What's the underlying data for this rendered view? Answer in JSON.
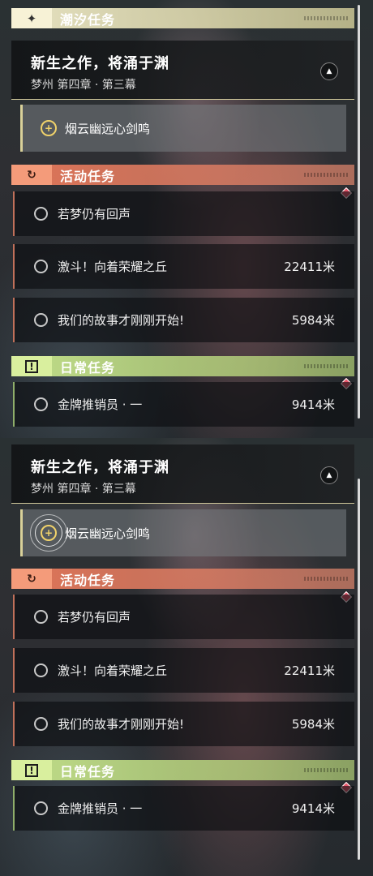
{
  "panels": [
    {
      "sections": {
        "tide": {
          "title": "潮汐任务",
          "icon": "star-icon"
        },
        "event": {
          "title": "活动任务",
          "icon": "refresh-icon"
        },
        "daily": {
          "title": "日常任务",
          "icon": "exclamation-box-icon"
        }
      },
      "main_quest": {
        "name": "新生之作，将涌于渊",
        "chapter": "梦州 第四章 · 第三幕"
      },
      "objective": {
        "label": "烟云幽远心剑鸣"
      },
      "event_tasks": [
        {
          "name": "若梦仍有回声",
          "distance": ""
        },
        {
          "name": "激斗！向着荣耀之丘",
          "distance": "22411米"
        },
        {
          "name": "我们的故事才刚刚开始!",
          "distance": "5984米"
        }
      ],
      "daily_tasks": [
        {
          "name": "金牌推销员 · 一",
          "distance": "9414米"
        }
      ]
    },
    {
      "sections": {
        "event": {
          "title": "活动任务",
          "icon": "refresh-icon"
        },
        "daily": {
          "title": "日常任务",
          "icon": "exclamation-box-icon"
        }
      },
      "main_quest": {
        "name": "新生之作，将涌于渊",
        "chapter": "梦州 第四章 · 第三幕"
      },
      "objective": {
        "label": "烟云幽远心剑鸣"
      },
      "event_tasks": [
        {
          "name": "若梦仍有回声",
          "distance": ""
        },
        {
          "name": "激斗！向着荣耀之丘",
          "distance": "22411米"
        },
        {
          "name": "我们的故事才刚刚开始!",
          "distance": "5984米"
        }
      ],
      "daily_tasks": [
        {
          "name": "金牌推销员 · 一",
          "distance": "9414米"
        }
      ]
    }
  ],
  "colors": {
    "tide_accent": "#f7f2d6",
    "event_accent": "#e8785a",
    "daily_accent": "#c8e68c",
    "pin": "#e9566a",
    "target": "#f0d26a"
  }
}
